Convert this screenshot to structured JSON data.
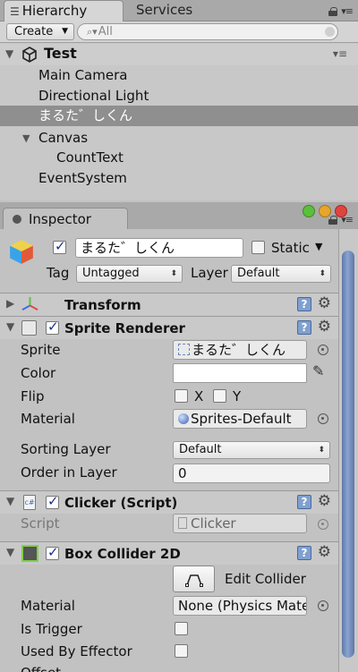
{
  "hierarchy": {
    "tab_label": "Hierarchy",
    "other_tab_label": "Services",
    "create_label": "Create",
    "search_placeholder": "All",
    "scene_name": "Test",
    "items": [
      {
        "label": "Main Camera"
      },
      {
        "label": "Directional Light"
      },
      {
        "label": "まるた゛しくん"
      },
      {
        "label": "Canvas"
      },
      {
        "label": "CountText"
      },
      {
        "label": "EventSystem"
      }
    ]
  },
  "inspector": {
    "tab_label": "Inspector",
    "object_name": "まるた゛しくん",
    "static_label": "Static",
    "tag_label": "Tag",
    "tag_value": "Untagged",
    "layer_label": "Layer",
    "layer_value": "Default",
    "transform": {
      "title": "Transform"
    },
    "sprite_renderer": {
      "title": "Sprite Renderer",
      "sprite_label": "Sprite",
      "sprite_value": "まるた゛しくん",
      "color_label": "Color",
      "flip_label": "Flip",
      "flip_x": "X",
      "flip_y": "Y",
      "material_label": "Material",
      "material_value": "Sprites-Default",
      "sorting_layer_label": "Sorting Layer",
      "sorting_layer_value": "Default",
      "order_label": "Order in Layer",
      "order_value": "0"
    },
    "clicker": {
      "title": "Clicker (Script)",
      "script_label": "Script",
      "script_value": "Clicker"
    },
    "box_collider": {
      "title": "Box Collider 2D",
      "edit_collider_label": "Edit Collider",
      "material_label": "Material",
      "material_value": "None (Physics Mate",
      "is_trigger_label": "Is Trigger",
      "used_by_effector_label": "Used By Effector",
      "offset_label": "Offset"
    }
  },
  "colors": {
    "selection": "#8f8f8f",
    "scrollbar": "#7089bb",
    "close_button": "#e0443e",
    "minimize_button": "#e6a62b",
    "maximize_button": "#5cbf3c"
  }
}
